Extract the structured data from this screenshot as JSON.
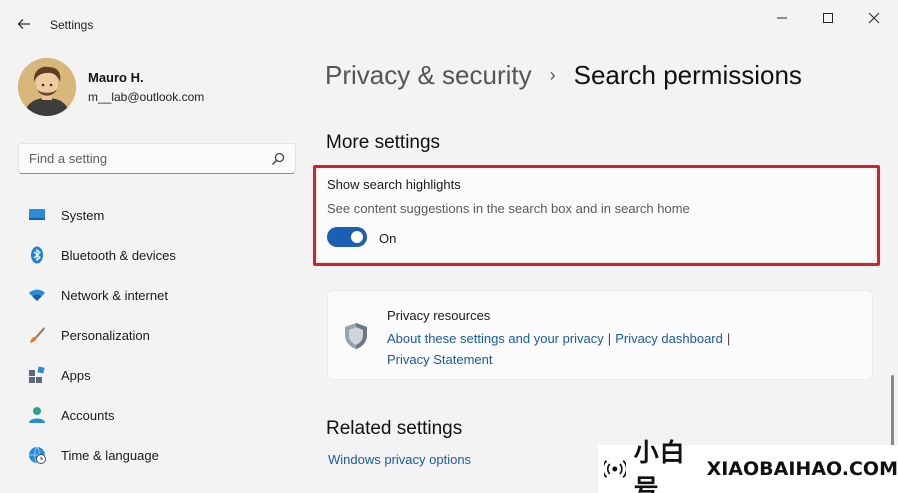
{
  "window": {
    "title": "Settings",
    "back_icon": "back-arrow-icon",
    "controls": [
      "minimize-icon",
      "maximize-icon",
      "close-icon"
    ]
  },
  "profile": {
    "name": "Mauro H.",
    "email": "m__lab@outlook.com"
  },
  "search": {
    "placeholder": "Find a setting",
    "icon": "search-icon"
  },
  "sidebar": {
    "items": [
      {
        "label": "System",
        "icon": "system-monitor-icon"
      },
      {
        "label": "Bluetooth & devices",
        "icon": "bluetooth-icon"
      },
      {
        "label": "Network & internet",
        "icon": "wifi-icon"
      },
      {
        "label": "Personalization",
        "icon": "brush-icon"
      },
      {
        "label": "Apps",
        "icon": "apps-icon"
      },
      {
        "label": "Accounts",
        "icon": "account-icon"
      },
      {
        "label": "Time & language",
        "icon": "globe-clock-icon"
      }
    ]
  },
  "breadcrumb": {
    "parent": "Privacy & security",
    "separator": "›",
    "current": "Search permissions"
  },
  "more_settings": {
    "heading": "More settings",
    "search_highlights": {
      "title": "Show search highlights",
      "description": "See content suggestions in the search box and in search home",
      "toggle_state": "On",
      "toggle_on": true
    }
  },
  "privacy_resources": {
    "title": "Privacy resources",
    "link_about": "About these settings and your privacy",
    "separator": "|",
    "link_dashboard": "Privacy dashboard",
    "link_statement": "Privacy Statement"
  },
  "related_settings": {
    "heading": "Related settings",
    "link": "Windows privacy options"
  },
  "watermark": {
    "chinese": "小白号",
    "latin": "XIAOBAIHAO.COM"
  },
  "colors": {
    "accent": "#1a5fb4",
    "highlight_border": "#cc2530",
    "background": "#f3f3f3",
    "card": "#fbfbfb"
  }
}
